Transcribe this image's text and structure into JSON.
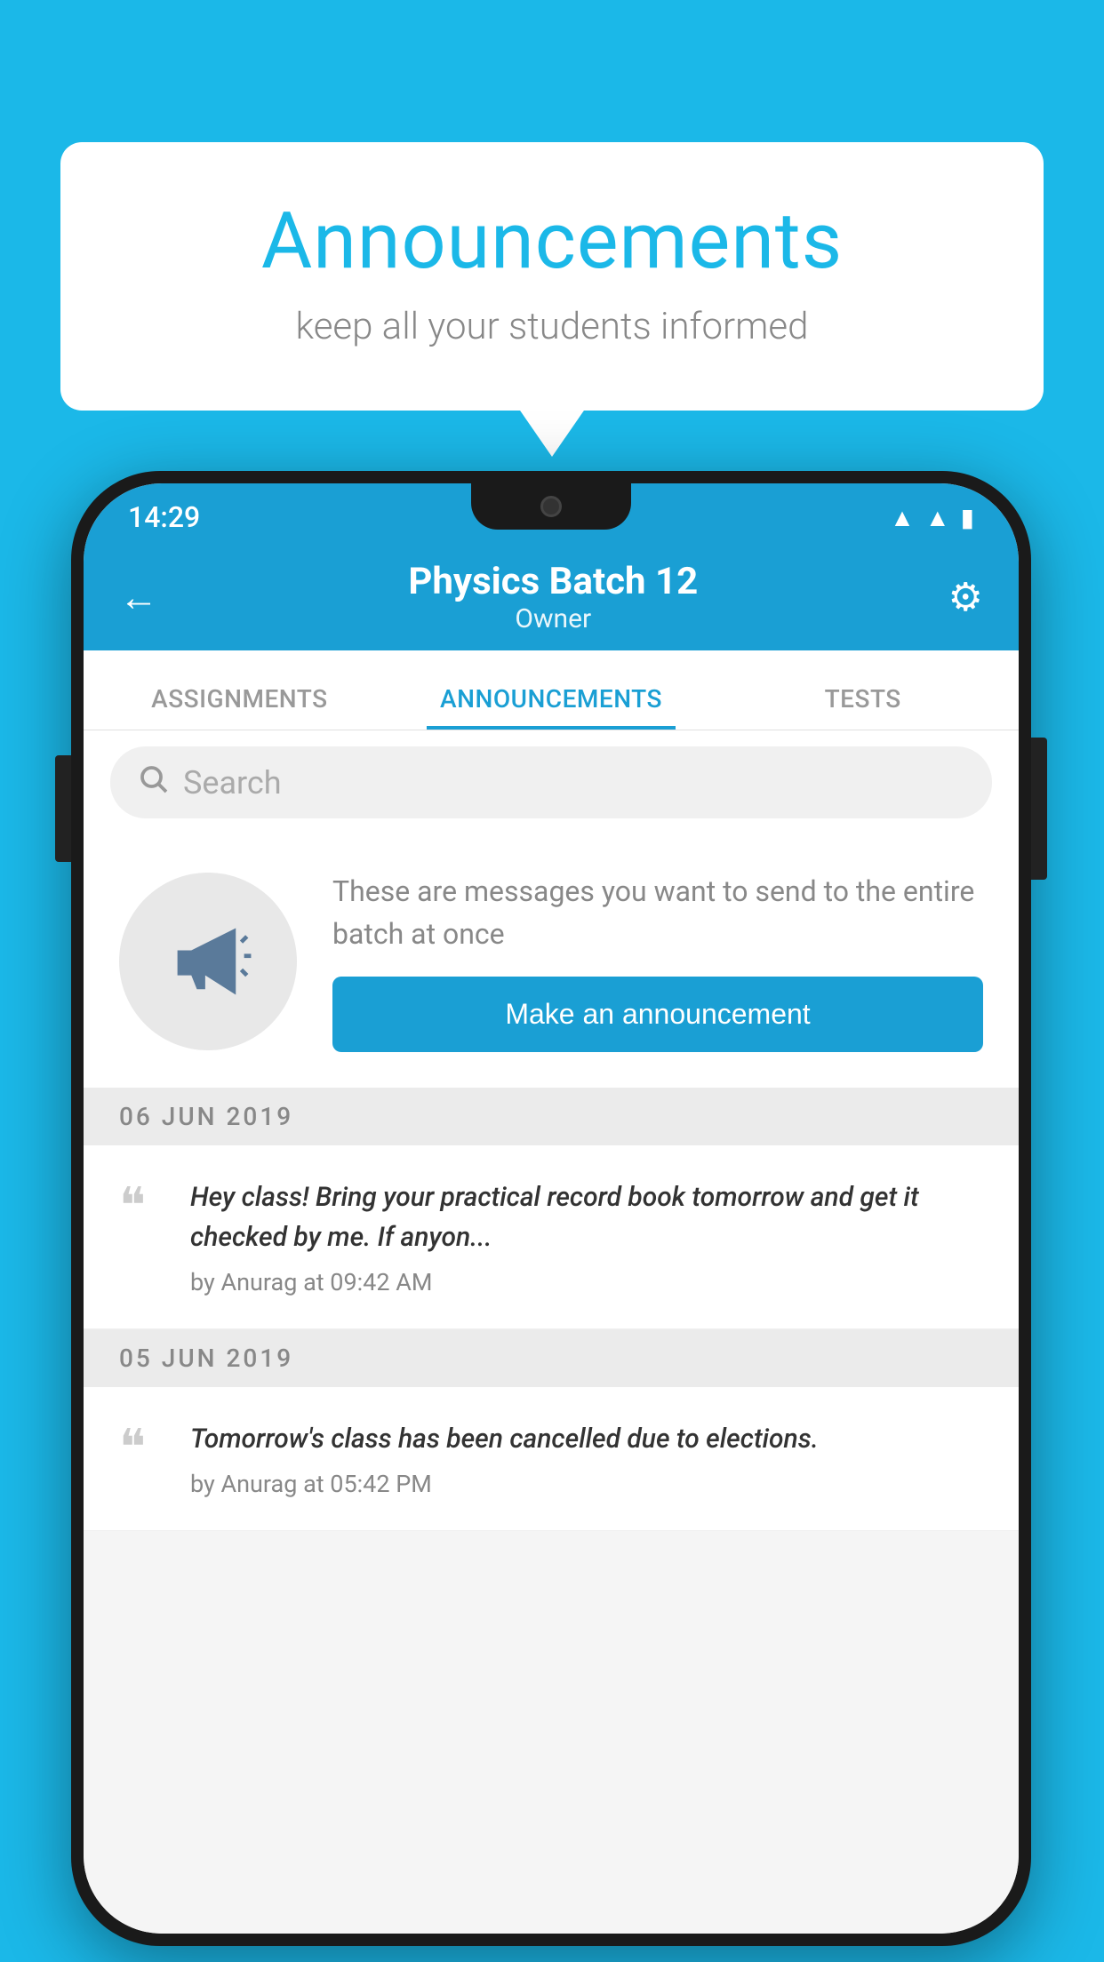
{
  "background_color": "#1BB8E8",
  "speech_bubble": {
    "title": "Announcements",
    "subtitle": "keep all your students informed"
  },
  "phone": {
    "status_bar": {
      "time": "14:29",
      "icons": [
        "wifi",
        "signal",
        "battery"
      ]
    },
    "header": {
      "back_label": "←",
      "title": "Physics Batch 12",
      "subtitle": "Owner",
      "gear_label": "⚙"
    },
    "tabs": [
      {
        "label": "ASSIGNMENTS",
        "active": false
      },
      {
        "label": "ANNOUNCEMENTS",
        "active": true
      },
      {
        "label": "TESTS",
        "active": false
      }
    ],
    "search": {
      "placeholder": "Search"
    },
    "announcement_card": {
      "description": "These are messages you want to\nsend to the entire batch at once",
      "button_label": "Make an announcement"
    },
    "messages": [
      {
        "date": "06  JUN  2019",
        "text": "Hey class! Bring your practical record book tomorrow and get it checked by me. If anyon...",
        "meta": "by Anurag at 09:42 AM"
      },
      {
        "date": "05  JUN  2019",
        "text": "Tomorrow's class has been cancelled due to elections.",
        "meta": "by Anurag at 05:42 PM"
      }
    ]
  }
}
